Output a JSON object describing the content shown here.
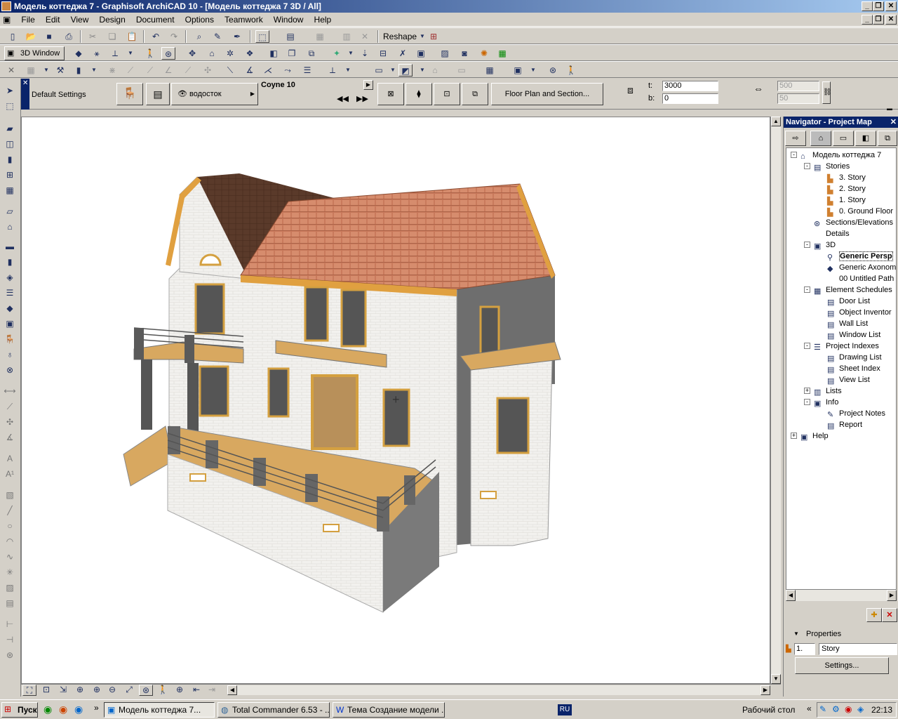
{
  "window": {
    "title": "Модель коттеджа 7 - Graphisoft ArchiCAD 10 - [Модель коттеджа 7 3D / All]"
  },
  "menu": [
    "File",
    "Edit",
    "View",
    "Design",
    "Document",
    "Options",
    "Teamwork",
    "Window",
    "Help"
  ],
  "toolbar": {
    "reshape_label": "Reshape",
    "window_label": "3D Window"
  },
  "infobox": {
    "settings_label": "Default Settings",
    "layer_label": "водосток",
    "material_label": "Coyne 10",
    "floorplan_button": "Floor Plan and Section...",
    "t_label": "t:",
    "t_value": "3000",
    "b_label": "b:",
    "b_value": "0",
    "w_value": "500",
    "h_value": "50"
  },
  "navigator": {
    "title": "Navigator - Project Map",
    "tree": [
      {
        "label": "Модель коттеджа 7",
        "level": 0,
        "icon": "house-icon",
        "exp": "-"
      },
      {
        "label": "Stories",
        "level": 1,
        "icon": "stories-icon",
        "exp": "-"
      },
      {
        "label": "3. Story",
        "level": 2,
        "icon": "story-icon"
      },
      {
        "label": "2. Story",
        "level": 2,
        "icon": "story-icon"
      },
      {
        "label": "1. Story",
        "level": 2,
        "icon": "story-icon"
      },
      {
        "label": "0. Ground Floor",
        "level": 2,
        "icon": "story-icon"
      },
      {
        "label": "Sections/Elevations",
        "level": 1,
        "icon": "section-icon"
      },
      {
        "label": "Details",
        "level": 1,
        "icon": "details-icon"
      },
      {
        "label": "3D",
        "level": 1,
        "icon": "3d-icon",
        "exp": "-"
      },
      {
        "label": "Generic Persp",
        "level": 2,
        "icon": "camera-icon",
        "selected": true
      },
      {
        "label": "Generic Axonom",
        "level": 2,
        "icon": "axon-icon"
      },
      {
        "label": "00 Untitled Path",
        "level": 2,
        "icon": "path-icon"
      },
      {
        "label": "Element Schedules",
        "level": 1,
        "icon": "schedule-icon",
        "exp": "-"
      },
      {
        "label": "Door List",
        "level": 2,
        "icon": "list-icon"
      },
      {
        "label": "Object Inventor",
        "level": 2,
        "icon": "list-icon"
      },
      {
        "label": "Wall List",
        "level": 2,
        "icon": "list-icon"
      },
      {
        "label": "Window List",
        "level": 2,
        "icon": "list-icon"
      },
      {
        "label": "Project Indexes",
        "level": 1,
        "icon": "index-icon",
        "exp": "-"
      },
      {
        "label": "Drawing List",
        "level": 2,
        "icon": "list-icon"
      },
      {
        "label": "Sheet Index",
        "level": 2,
        "icon": "list-icon"
      },
      {
        "label": "View List",
        "level": 2,
        "icon": "list-icon"
      },
      {
        "label": "Lists",
        "level": 1,
        "icon": "lists-icon",
        "exp": "+"
      },
      {
        "label": "Info",
        "level": 1,
        "icon": "info-icon",
        "exp": "-"
      },
      {
        "label": "Project Notes",
        "level": 2,
        "icon": "notes-icon"
      },
      {
        "label": "Report",
        "level": 2,
        "icon": "report-icon"
      },
      {
        "label": "Help",
        "level": 0,
        "icon": "help-icon",
        "exp": "+"
      }
    ],
    "properties_label": "Properties",
    "prop_number": "1.",
    "prop_value": "Story",
    "settings_button": "Settings..."
  },
  "taskbar": {
    "start": "Пуск",
    "tasks": [
      "Модель коттеджа 7...",
      "Total Commander 6.53 - ...",
      "Тема Создание модели ..."
    ],
    "lang": "RU",
    "desktop": "Рабочий стол",
    "clock": "22:13"
  }
}
